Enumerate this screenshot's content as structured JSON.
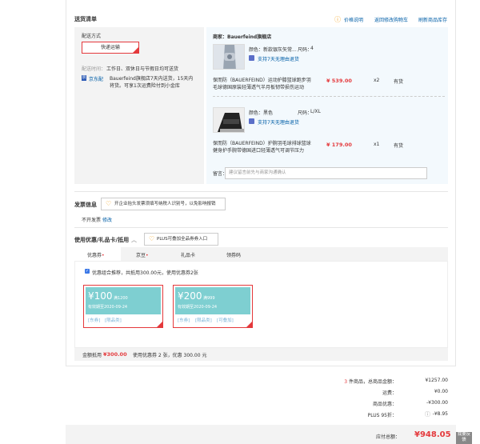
{
  "section": {
    "title": "送货清单",
    "links": [
      "价格说明",
      "返回修改购物车",
      "刷新商品库存"
    ]
  },
  "delivery": {
    "method_label": "配送方式",
    "method_value": "快递运输",
    "time_label": "配送时间：",
    "time_value": "工作日、双休日与节假日均可送货",
    "tag": "京东配",
    "note": "Bauerfeind旗舰店7天内送货，15天内将货。可享1次运费险付到小金库"
  },
  "shop": {
    "name": "商家：Bauerfeind旗舰店",
    "items": [
      {
        "attr_line": "颜色：新款银灰矢常...",
        "size_label": "尺码：",
        "size_value": "4",
        "return": "支持7天无理由退货",
        "name": "保而防（BAUERFEIND）运动护膝篮球跑步羽毛球德国原装轻薄透气半月板韧带损伤运动",
        "price": "¥ 539.00",
        "qty": "x2",
        "stock": "有货"
      },
      {
        "attr_line": "颜色：黑色",
        "size_label": "尺码：",
        "size_value": "L/XL",
        "return": "支持7天无理由退货",
        "name": "保而防（BAUERFEIND）护腕羽毛球排球篮球健身护手腕带德国进口轻薄透气可调节压力",
        "price": "¥ 179.00",
        "qty": "x1",
        "stock": "有货"
      }
    ],
    "note_label": "留言：",
    "note_placeholder": "建议留言前先与商家沟通确认"
  },
  "invoice": {
    "title": "发票信息",
    "tip": "开企业抬头发票须填写纳税人识别号，以免影响报销",
    "state": "不开发票",
    "edit": "修改"
  },
  "coupons": {
    "title": "使用优惠/礼品卡/抵用",
    "plus_tip": "PLUS可叠加全品券券入口",
    "tabs": [
      "优惠券",
      "京豆",
      "礼品卡",
      "领券码"
    ],
    "checkbox_label": "优惠组合推荐，共抵用300.00元，使用优惠券2张",
    "list": [
      {
        "amount": "¥100",
        "condition": "满1200",
        "expire": "有效期至2020-09-24",
        "tags": [
          "[东券]",
          "[限品类]"
        ]
      },
      {
        "amount": "¥200",
        "condition": "满999",
        "expire": "有效期至2020-09-24",
        "tags": [
          "[东券]",
          "[限品类]",
          "[可叠加]"
        ]
      }
    ],
    "footer_label": "金额抵用",
    "footer_amount": "¥300.00",
    "footer_note": "使用优惠券 2 张，优惠 300.00 元"
  },
  "summary": {
    "count_num": "3",
    "count_label": "件商品，总商品金额：",
    "count_value": "¥1257.00",
    "shipping_label": "运费：",
    "shipping_value": "¥0.00",
    "discount_label": "商品优惠：",
    "discount_value": "-¥300.00",
    "plus_label": "PLUS 95折：",
    "plus_value": "-¥8.95",
    "grand_label": "应付总额：",
    "grand_value": "¥948.05",
    "feedback": "我要反馈"
  }
}
